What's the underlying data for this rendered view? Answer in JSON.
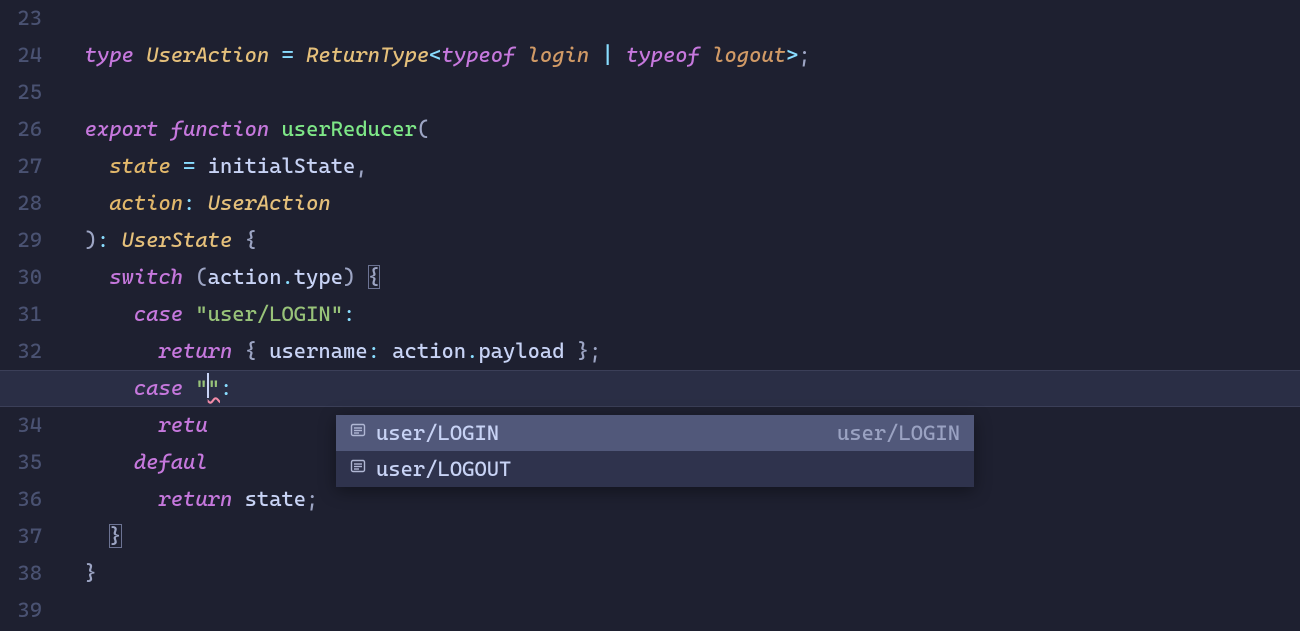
{
  "gutter": {
    "start": 23,
    "end": 39,
    "highlighted": 33
  },
  "tokens": {
    "l24": {
      "type_kw": "type",
      "UserAction": "UserAction",
      "eq": " = ",
      "ReturnType": "ReturnType",
      "lt": "<",
      "typeof1": "typeof",
      "sp1": " ",
      "login": "login",
      "bar": " | ",
      "typeof2": "typeof",
      "sp2": " ",
      "logout": "logout",
      "gt": ">",
      "semi": ";"
    },
    "l26": {
      "export": "export",
      "sp1": " ",
      "function": "function",
      "sp2": " ",
      "userReducer": "userReducer",
      "lp": "("
    },
    "l27": {
      "state": "state",
      "eq": " = ",
      "initialState": "initialState",
      "comma": ","
    },
    "l28": {
      "action": "action",
      "colon": ": ",
      "UserAction": "UserAction"
    },
    "l29": {
      "rp": ")",
      "colon": ": ",
      "UserState": "UserState",
      "sp": " ",
      "lb": "{"
    },
    "l30": {
      "switch": "switch",
      "sp": " ",
      "lp": "(",
      "action": "action",
      "dot": ".",
      "type": "type",
      "rp": ")",
      "sp2": " ",
      "lb": "{"
    },
    "l31": {
      "case": "case",
      "sp": " ",
      "q1": "\"",
      "str": "user/LOGIN",
      "q2": "\"",
      "colon": ":"
    },
    "l32": {
      "return": "return",
      "sp": " ",
      "lb": "{ ",
      "username": "username",
      "colon": ": ",
      "action": "action",
      "dot": ".",
      "payload": "payload",
      "rb": " }",
      "semi": ";"
    },
    "l33": {
      "case": "case",
      "sp": " ",
      "q1": "\"",
      "q2": "\"",
      "colon": ":"
    },
    "l34": {
      "retu": "retu"
    },
    "l35": {
      "defaul": "defaul"
    },
    "l36": {
      "return": "return",
      "sp": " ",
      "state": "state",
      "semi": ";"
    },
    "l37": {
      "rb": "}"
    },
    "l38": {
      "rb": "}"
    }
  },
  "autocomplete": {
    "items": [
      {
        "label": "user/LOGIN",
        "detail": "user/LOGIN",
        "icon": "enum",
        "selected": true
      },
      {
        "label": "user/LOGOUT",
        "detail": "",
        "icon": "enum",
        "selected": false
      }
    ]
  }
}
